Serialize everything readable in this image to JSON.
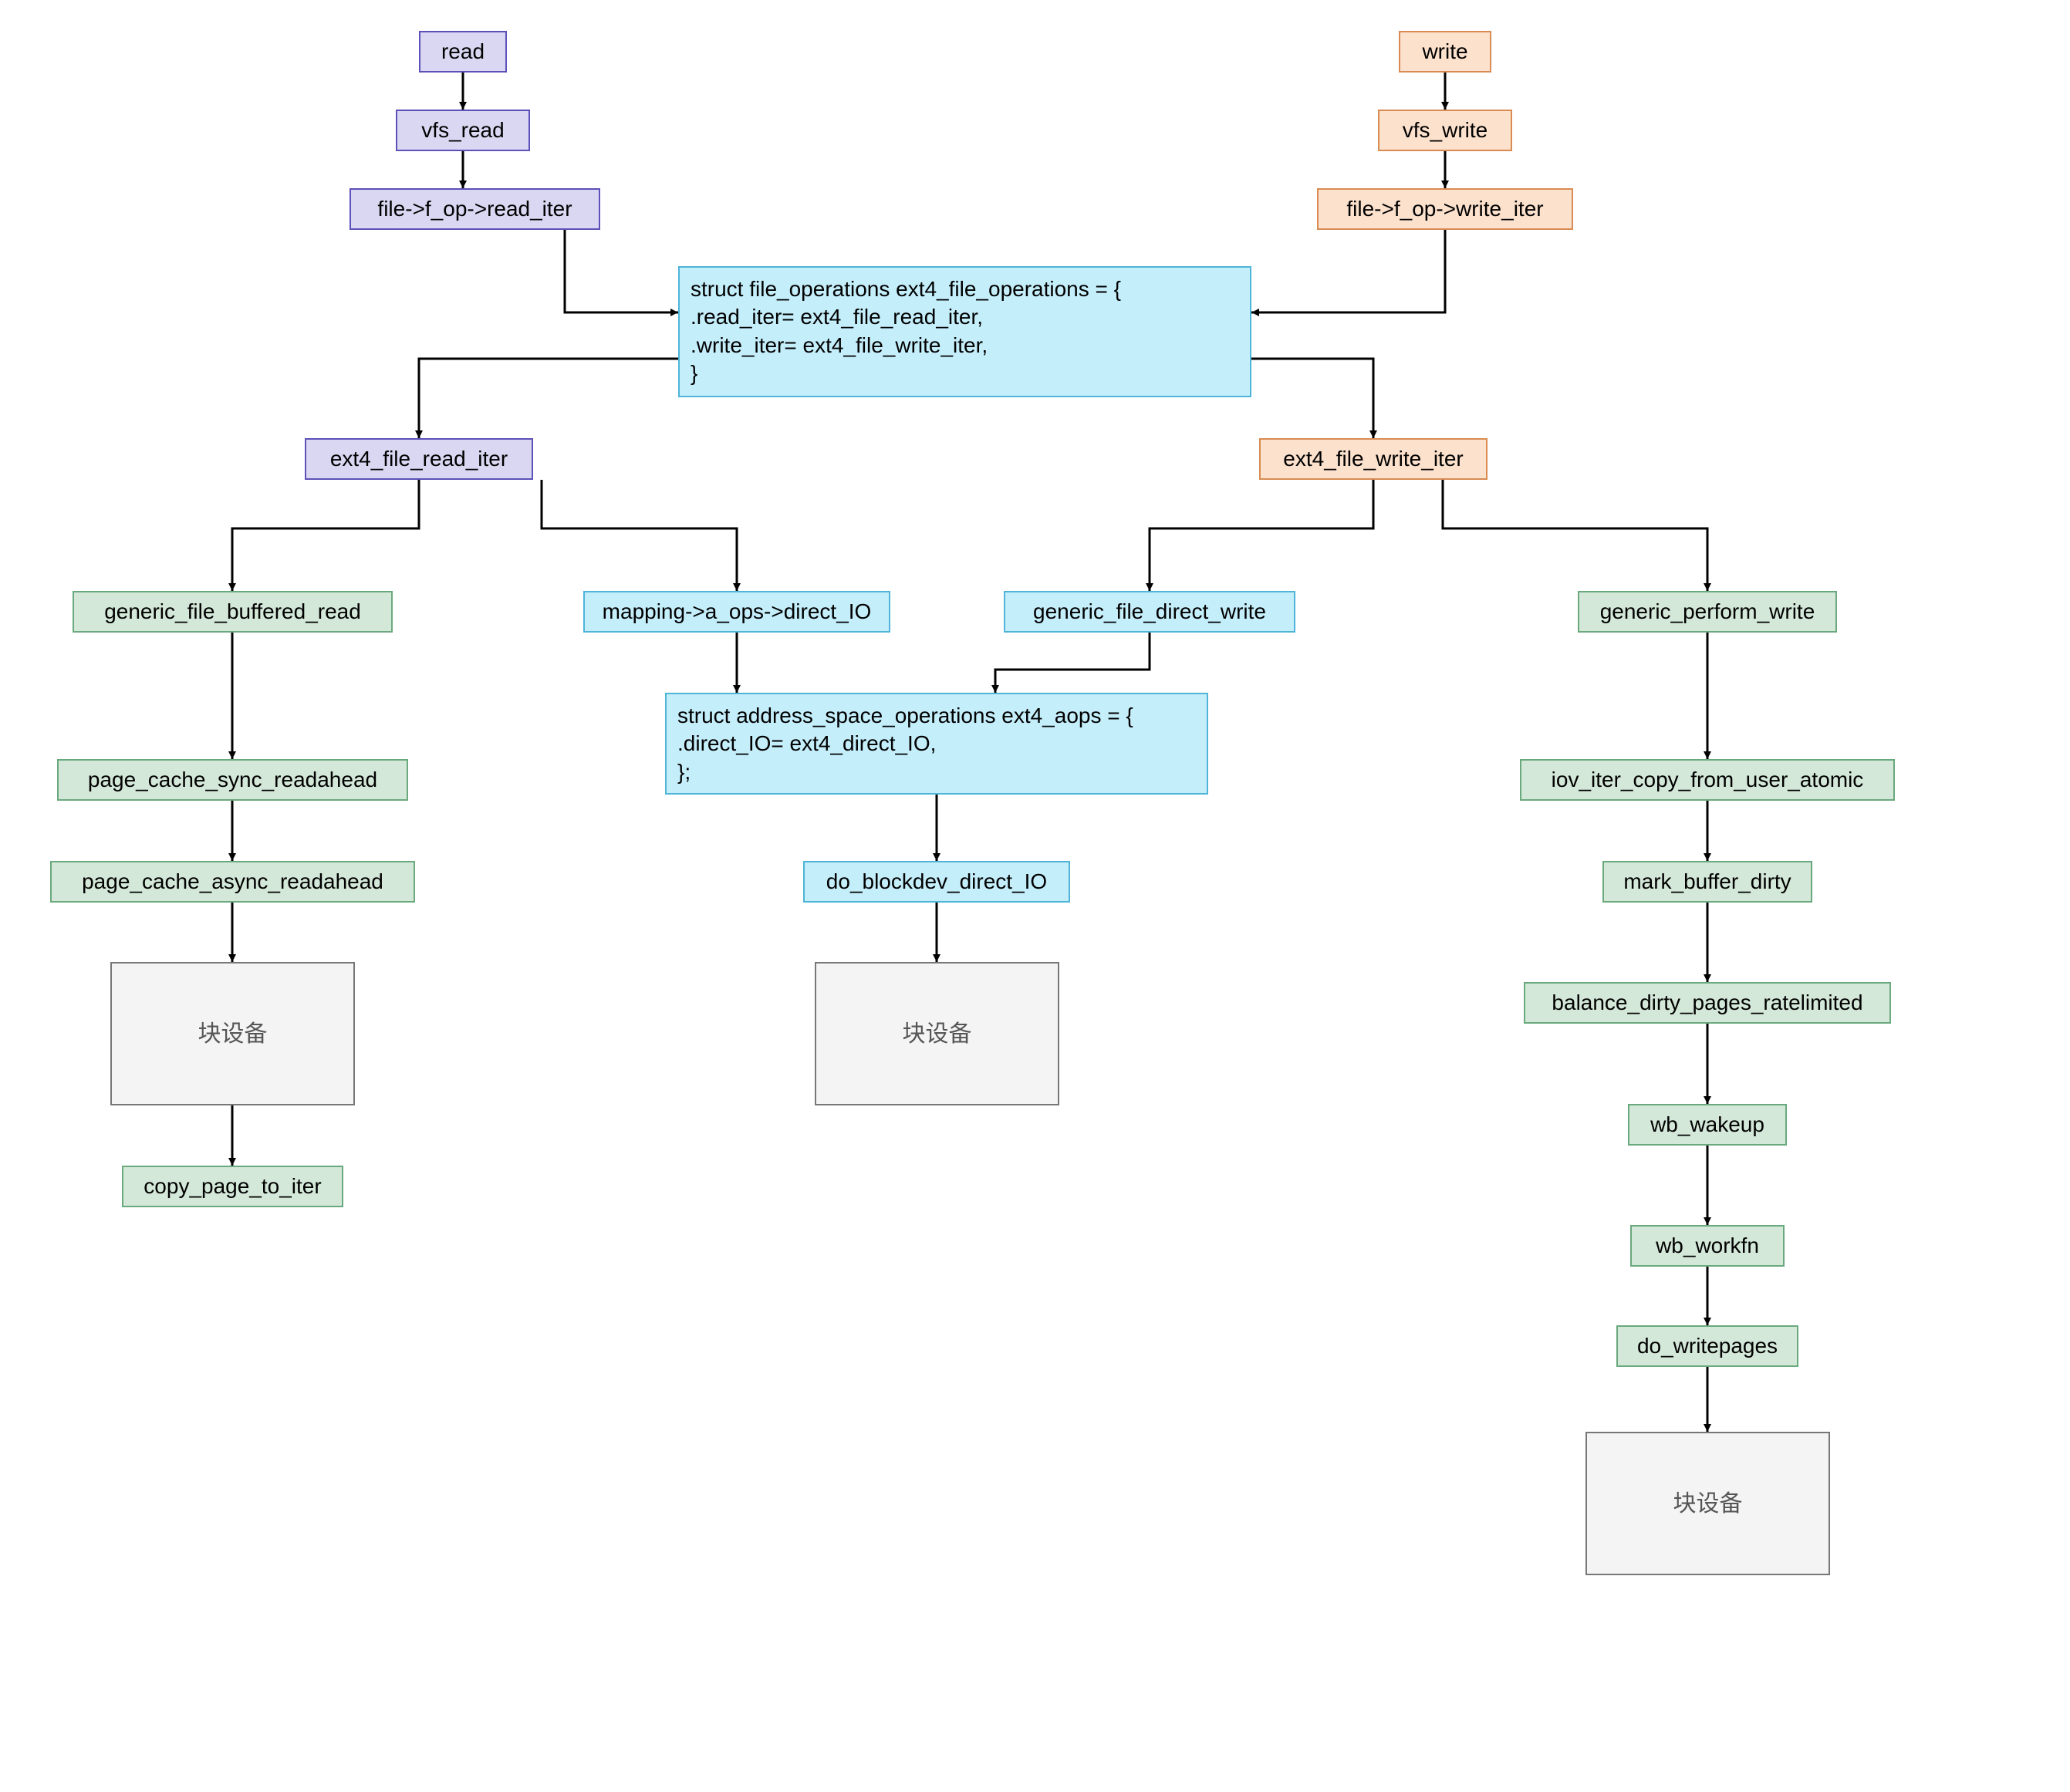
{
  "nodes": {
    "read": "read",
    "vfs_read": "vfs_read",
    "read_iter": "file->f_op->read_iter",
    "write": "write",
    "vfs_write": "vfs_write",
    "write_iter": "file->f_op->write_iter",
    "file_ops": "struct file_operations ext4_file_operations = {\n.read_iter= ext4_file_read_iter,\n.write_iter= ext4_file_write_iter,\n}",
    "ext4_read_iter": "ext4_file_read_iter",
    "ext4_write_iter": "ext4_file_write_iter",
    "gen_buf_read": "generic_file_buffered_read",
    "mapping_dio": "mapping->a_ops->direct_IO",
    "gen_direct_write": "generic_file_direct_write",
    "gen_perform_write": "generic_perform_write",
    "aops": "struct address_space_operations ext4_aops = {\n.direct_IO= ext4_direct_IO,\n};",
    "page_sync": "page_cache_sync_readahead",
    "page_async": "page_cache_async_readahead",
    "do_blockdev": "do_blockdev_direct_IO",
    "iov_copy": "iov_iter_copy_from_user_atomic",
    "mark_dirty": "mark_buffer_dirty",
    "balance_dirty": "balance_dirty_pages_ratelimited",
    "wb_wakeup": "wb_wakeup",
    "wb_workfn": "wb_workfn",
    "do_writepages": "do_writepages",
    "blkdev1": "块设备",
    "blkdev2": "块设备",
    "blkdev3": "块设备",
    "copy_page": "copy_page_to_iter"
  }
}
